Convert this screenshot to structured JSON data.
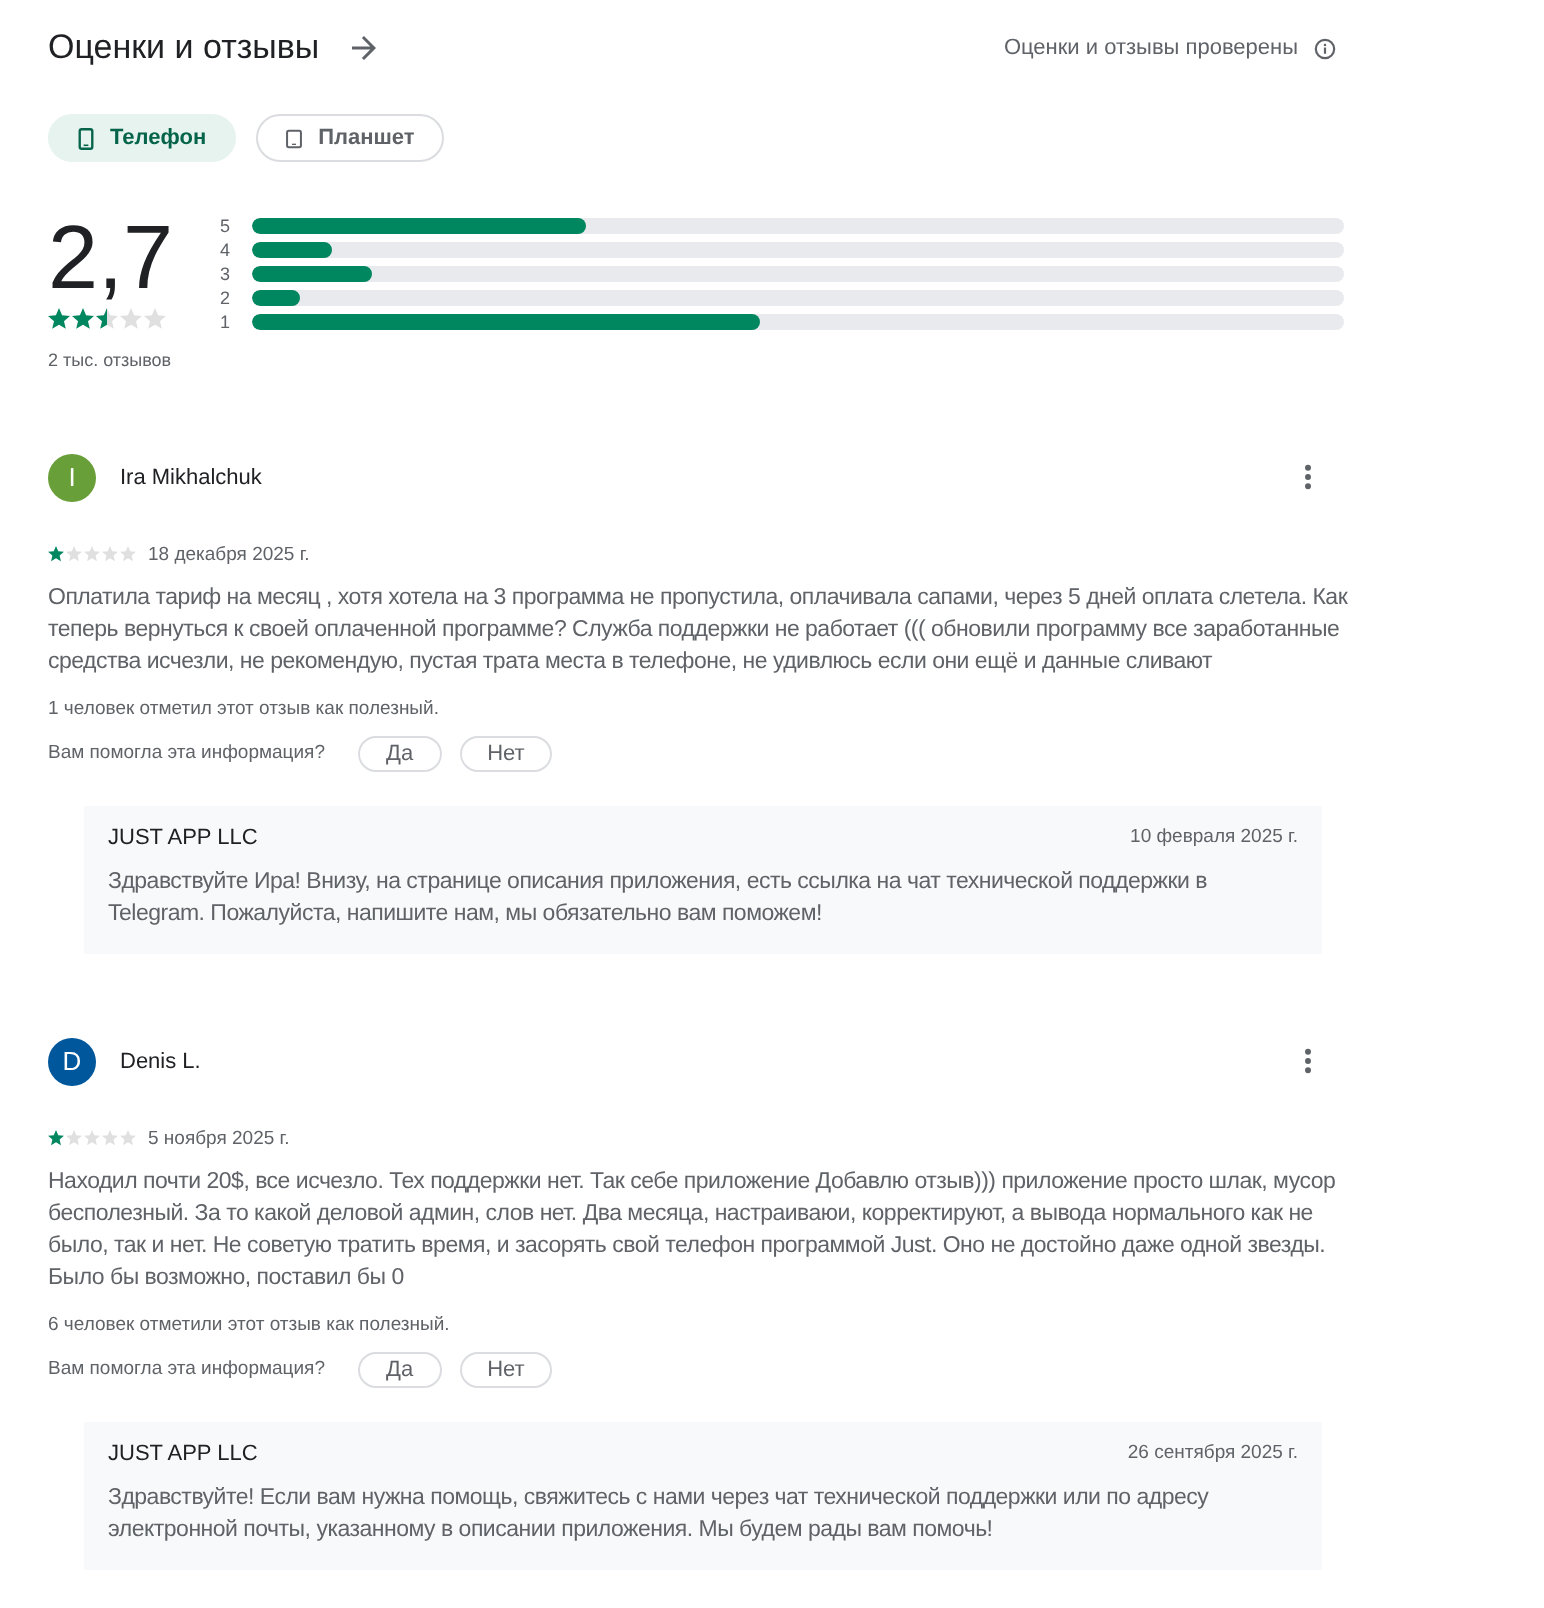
{
  "header": {
    "title": "Оценки и отзывы",
    "verified_note": "Оценки и отзывы проверены"
  },
  "device_tabs": [
    {
      "label": "Телефон",
      "kind": "phone",
      "selected": true
    },
    {
      "label": "Планшет",
      "kind": "tablet",
      "selected": false
    }
  ],
  "summary": {
    "rating": "2,7",
    "stars": 2.5,
    "count": "2 тыс. отзывов",
    "distribution": [
      {
        "label": "5",
        "level": 0.306
      },
      {
        "label": "4",
        "level": 0.074
      },
      {
        "label": "3",
        "level": 0.109
      },
      {
        "label": "2",
        "level": 0.044
      },
      {
        "label": "1",
        "level": 0.465
      }
    ]
  },
  "reviews": [
    {
      "author": "Ira Mikhalchuk",
      "initial": "I",
      "color": "#689f38",
      "stars": 1,
      "date": "18 декабря 2025 г.",
      "text": "Оплатила тариф на месяц , хотя хотела на 3 программа не пропустила, оплачивала сапами, через 5 дней оплата слетела. Как теперь вернуться к своей оплаченной программе? Служба поддержки не работает ((( обновили программу все заработанные средства исчезли, не рекомендую, пустая трата места в телефоне, не удивлюсь если они ещё и данные сливают",
      "helpful_count": "1 человек отметил этот отзыв как полезный.",
      "helpful_question": "Вам помогла эта информация?",
      "answers": [
        "Да",
        "Нет"
      ],
      "reply": {
        "author": "JUST APP LLC",
        "date": "10 февраля 2025 г.",
        "text": "Здравствуйте Ира! Внизу, на странице описания приложения, есть ссылка на чат технической поддержки в Telegram. Пожалуйста, напишите нам, мы обязательно вам поможем!"
      }
    },
    {
      "author": "Denis L.",
      "initial": "D",
      "color": "#01579b",
      "stars": 1,
      "date": "5 ноября 2025 г.",
      "text": "Находил почти 20$, все исчезло. Тех поддержки нет. Так себе приложение Добавлю отзыв))) приложение просто шлак, мусор бесполезный. За то какой деловой админ, слов нет. Два месяца, настраиваюи, корректируют, а вывода нормального как не было, так и нет. Не советую тратить время, и засорять свой телефон программой Just. Оно не достойно даже одной звезды. Было бы возможно, поставил бы 0",
      "helpful_count": "6 человек отметили этот отзыв как полезный.",
      "helpful_question": "Вам помогла эта информация?",
      "answers": [
        "Да",
        "Нет"
      ],
      "reply": {
        "author": "JUST APP LLC",
        "date": "26 сентября 2025 г.",
        "text": "Здравствуйте! Если вам нужна помощь, свяжитесь с нами через чат технической поддержки или по адресу электронной почты, указанному в описании приложения. Мы будем рады вам помочь!"
      }
    }
  ]
}
